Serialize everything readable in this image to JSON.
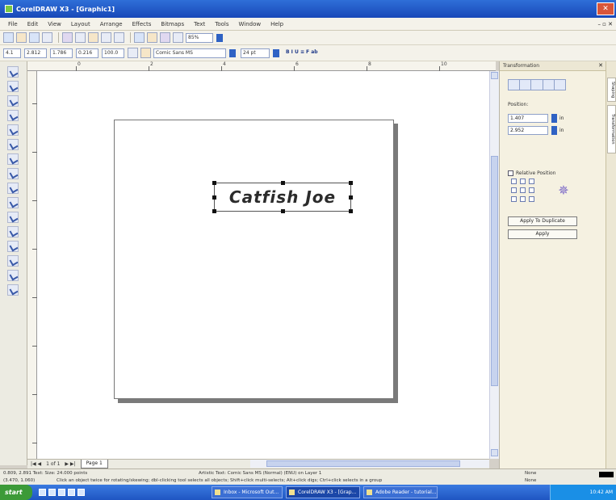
{
  "window": {
    "title": "CorelDRAW X3 - [Graphic1]",
    "close_glyph": "✕"
  },
  "menu": [
    "File",
    "Edit",
    "View",
    "Layout",
    "Arrange",
    "Effects",
    "Bitmaps",
    "Text",
    "Tools",
    "Window",
    "Help"
  ],
  "menu_doc_controls": "– ▫ ✕",
  "toolbar": {
    "zoom": "85%",
    "pos_x": "4.1",
    "pos_y": "2.812",
    "size_w": "1.786",
    "size_h": "0.216",
    "scale": "100.0",
    "font_name": "Comic Sans MS",
    "font_size": "24 pt",
    "text_formatting_glyphs": "B I U  ≡  F  ab"
  },
  "ruler_labels": [
    "0",
    "2",
    "4",
    "6",
    "8",
    "10"
  ],
  "canvas": {
    "text_object": "Catfish Joe"
  },
  "docker": {
    "title": "Transformation",
    "close": "✕",
    "position_label": "Position:",
    "h_value": "1.407",
    "v_value": "2.952",
    "unit": "in",
    "relative_position": "Relative Position",
    "apply_to_duplicate": "Apply To Duplicate",
    "apply": "Apply",
    "tabs": [
      "Shaping",
      "Transformation"
    ]
  },
  "page_nav": {
    "controls_left": "|◀ ◀",
    "counter": "1 of 1",
    "controls_right": "▶ ▶|",
    "page_tab": "Page 1"
  },
  "status": {
    "line1_left": "0.809, 2.891 Text: Size: 24.000 points",
    "line1_mid": "Artistic Text: Comic Sans MS (Normal) (ENU) on Layer 1",
    "line2_left": "(3.470, 1.060)",
    "line2_mid": "Click an object twice for rotating/skewing; dbl-clicking tool selects all objects; Shift+click multi-selects; Alt+click digs; Ctrl+click selects in a group",
    "right1": "None",
    "right2": "None"
  },
  "taskbar": {
    "start": "start",
    "tasks": [
      "Inbox - Microsoft Out...",
      "CorelDRAW X3 - [Grap...",
      "Adobe Reader - tutorial..."
    ],
    "tray_time": "10:42 AM"
  }
}
